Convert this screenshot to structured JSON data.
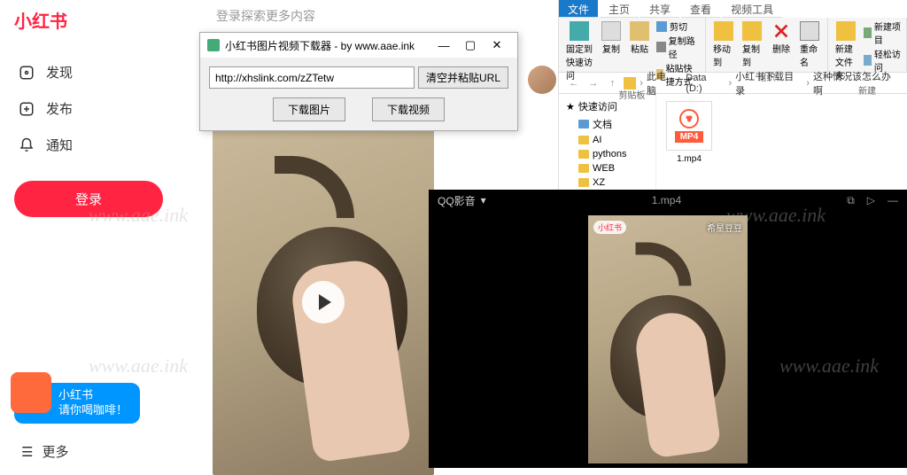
{
  "xhs": {
    "logo": "小红书",
    "nav": {
      "discover": "发现",
      "publish": "发布",
      "notify": "通知"
    },
    "login": "登录",
    "coffee_line1": "小红书",
    "coffee_line2": "请你喝咖啡！",
    "more": "更多",
    "search_hint": "登录探索更多内容"
  },
  "downloader": {
    "title": "小红书图片视频下载器 - by www.aae.ink",
    "url": "http://xhslink.com/zZTetw",
    "clear_btn": "清空并粘贴URL",
    "dl_image": "下载图片",
    "dl_video": "下载视频"
  },
  "explorer": {
    "tabs": {
      "file": "文件",
      "home": "主页",
      "share": "共享",
      "view": "查看",
      "video": "视频工具"
    },
    "ribbon": {
      "pin": "固定到快速访问",
      "copy": "复制",
      "paste": "粘贴",
      "cut": "剪切",
      "copypath": "复制路径",
      "paste_shortcut": "粘贴快捷方式",
      "moveto": "移动到",
      "copyto": "复制到",
      "delete": "删除",
      "rename": "重命名",
      "newfolder": "新建文件夹",
      "newitem": "新建项目",
      "easy": "轻松访问",
      "clipboard": "剪贴板",
      "organize": "组织",
      "new": "新建"
    },
    "breadcrumb": [
      "此电脑",
      "Data (D:)",
      "小红书下载目录",
      "这种情况该怎么办啊"
    ],
    "tree": {
      "quick": "快速访问",
      "items": [
        "文档",
        "AI",
        "pythons",
        "WEB",
        "XZ"
      ]
    },
    "file": {
      "name": "1.mp4",
      "badge": "MP4"
    }
  },
  "qqplayer": {
    "app": "QQ影音",
    "title": "1.mp4",
    "overlay_tl": "小红书",
    "overlay_tr": "希星豆豆"
  },
  "watermark": "www.aae.ink"
}
